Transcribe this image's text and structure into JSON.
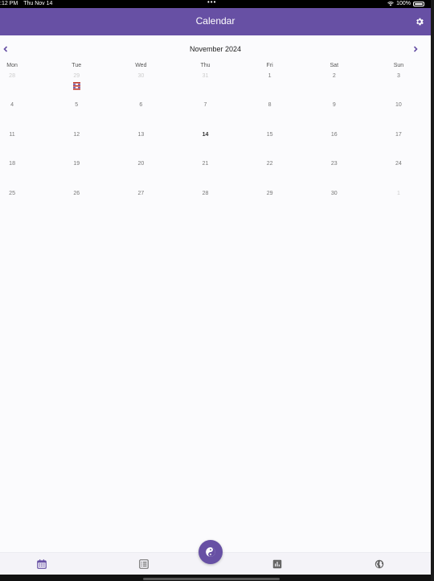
{
  "status_bar": {
    "time": ":12 PM",
    "date": "Thu Nov 14",
    "dots": "•••",
    "battery": "100%"
  },
  "app_bar": {
    "title": "Calendar",
    "settings_icon": "gear-icon"
  },
  "calendar": {
    "month_label": "November 2024",
    "weekdays": [
      "Mon",
      "Tue",
      "Wed",
      "Thu",
      "Fri",
      "Sat",
      "Sun"
    ],
    "weeks": [
      [
        {
          "d": "28",
          "other": true
        },
        {
          "d": "29",
          "other": true,
          "marker": true
        },
        {
          "d": "30",
          "other": true
        },
        {
          "d": "31",
          "other": true
        },
        {
          "d": "1"
        },
        {
          "d": "2"
        },
        {
          "d": "3"
        }
      ],
      [
        {
          "d": "4"
        },
        {
          "d": "5"
        },
        {
          "d": "6"
        },
        {
          "d": "7"
        },
        {
          "d": "8"
        },
        {
          "d": "9"
        },
        {
          "d": "10"
        }
      ],
      [
        {
          "d": "11"
        },
        {
          "d": "12"
        },
        {
          "d": "13"
        },
        {
          "d": "14",
          "today": true
        },
        {
          "d": "15"
        },
        {
          "d": "16"
        },
        {
          "d": "17"
        }
      ],
      [
        {
          "d": "18"
        },
        {
          "d": "19"
        },
        {
          "d": "20"
        },
        {
          "d": "21"
        },
        {
          "d": "22"
        },
        {
          "d": "23"
        },
        {
          "d": "24"
        }
      ],
      [
        {
          "d": "25"
        },
        {
          "d": "26"
        },
        {
          "d": "27"
        },
        {
          "d": "28"
        },
        {
          "d": "29"
        },
        {
          "d": "30"
        },
        {
          "d": "1",
          "other": true
        }
      ]
    ]
  },
  "bottom_nav": {
    "items": [
      {
        "icon": "calendar-icon",
        "active": true
      },
      {
        "icon": "journal-icon",
        "active": false
      },
      {
        "icon": "yin-yang-icon",
        "active": false
      },
      {
        "icon": "bar-chart-icon",
        "active": false
      },
      {
        "icon": "globe-icon",
        "active": false
      }
    ]
  },
  "colors": {
    "primary": "#6750a4",
    "background": "#fbfbfd",
    "marker_red": "#c0392b",
    "marker_purple": "#6750a4"
  }
}
